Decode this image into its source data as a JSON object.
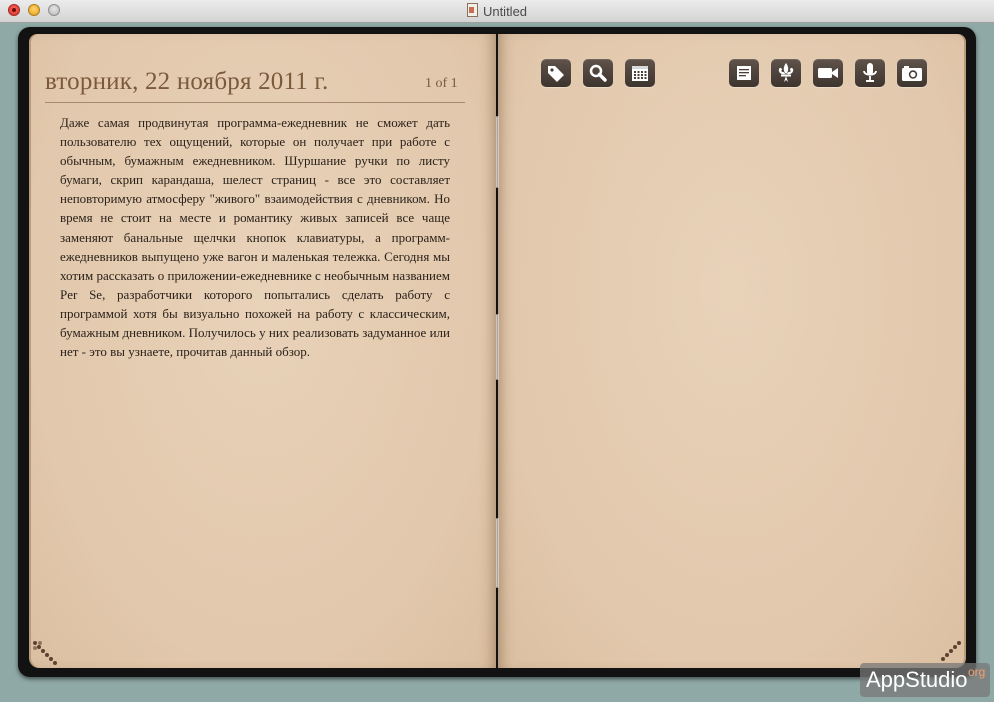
{
  "window": {
    "title": "Untitled"
  },
  "diary": {
    "date": "вторник, 22 ноября 2011 г.",
    "page_count": "1 of 1",
    "entry": "Даже самая продвинутая программа-ежедневник не сможет дать пользователю тех ощущений, которые он получает при работе с обычным, бумажным ежедневником. Шуршание ручки по листу бумаги, скрип карандаша, шелест страниц - все это составляет неповторимую атмосферу \"живого\" взаимодействия с дневником. Но время не стоит на месте и романтику живых записей все чаще заменяют банальные щелчки кнопок клавиатуры, а программ-ежедневников выпущено уже вагон и маленькая тележка. Сегодня мы хотим рассказать о приложении-ежедневнике с необычным названием Per Se, разработчики которого попытались сделать работу с программой хотя бы визуально похожей на работу с классическим, бумажным дневником. Получилось у них реализовать задуманное или нет - это вы узнаете, прочитав данный обзор."
  },
  "toolbar": {
    "left_icons": [
      "tag-icon",
      "search-icon",
      "calendar-icon"
    ],
    "right_icons": [
      "document-icon",
      "fleur-de-lis-icon",
      "video-camera-icon",
      "microphone-icon",
      "photo-camera-icon"
    ]
  },
  "watermark": {
    "text": "AppStudio",
    "suffix": "org"
  },
  "colors": {
    "page": "#e5cdb2",
    "ink": "#7b5a3c",
    "cover": "#121212",
    "desktop": "#8fa9a6",
    "button": "#4a3f38"
  }
}
